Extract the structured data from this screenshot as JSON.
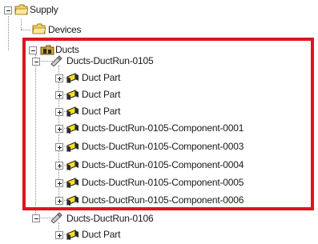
{
  "tree": {
    "root": {
      "label": "Supply",
      "expanded": true,
      "icon": "folder-icon"
    },
    "devices": {
      "label": "Devices",
      "icon": "folder-icon"
    },
    "ducts": {
      "label": "Ducts",
      "expanded": true,
      "icon": "ducts-group-icon"
    },
    "duct_runs": [
      {
        "label": "Ducts-DuctRun-0105",
        "expanded": true,
        "icon": "duct-run-icon",
        "children": [
          {
            "label": "Duct Part",
            "icon": "duct-part-icon"
          },
          {
            "label": "Duct Part",
            "icon": "duct-part-icon"
          },
          {
            "label": "Duct Part",
            "icon": "duct-part-icon"
          },
          {
            "label": "Ducts-DuctRun-0105-Component-0001",
            "icon": "duct-part-icon"
          },
          {
            "label": "Ducts-DuctRun-0105-Component-0003",
            "icon": "duct-part-icon"
          },
          {
            "label": "Ducts-DuctRun-0105-Component-0004",
            "icon": "duct-part-icon"
          },
          {
            "label": "Ducts-DuctRun-0105-Component-0005",
            "icon": "duct-part-icon"
          },
          {
            "label": "Ducts-DuctRun-0105-Component-0006",
            "icon": "duct-part-icon"
          }
        ]
      },
      {
        "label": "Ducts-DuctRun-0106",
        "expanded": true,
        "icon": "duct-run-icon",
        "children": [
          {
            "label": "Duct Part",
            "icon": "duct-part-icon"
          }
        ]
      }
    ]
  },
  "highlight": {
    "color": "#e0141e"
  },
  "colors": {
    "folder": "#f3d36b",
    "part_yellow": "#f7e11a",
    "part_dark": "#2b2b2b",
    "tree_lines": "#8a8a8a"
  }
}
